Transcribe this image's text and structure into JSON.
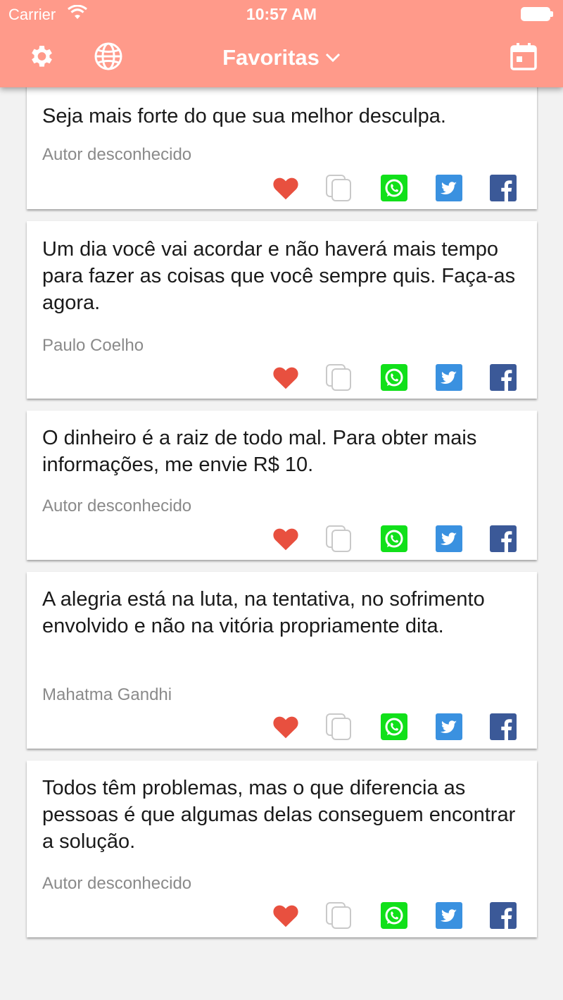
{
  "status": {
    "carrier": "Carrier",
    "time": "10:57 AM"
  },
  "nav": {
    "title": "Favoritas",
    "left_icons": [
      "gear-icon",
      "globe-icon"
    ],
    "right_icon": "calendar-icon",
    "color": "#ff9a8a"
  },
  "quotes": [
    {
      "text": "Seja mais forte do que sua melhor desculpa.",
      "author": "Autor desconhecido"
    },
    {
      "text": "Um dia você vai acordar e não haverá mais tempo para fazer as coisas que você sempre quis. Faça-as agora.",
      "author": "Paulo Coelho"
    },
    {
      "text": "O dinheiro é a raiz de todo mal. Para obter mais informações, me envie R$ 10.",
      "author": "Autor desconhecido"
    },
    {
      "text": "A alegria está na luta, na tentativa, no sofrimento envolvido e não na vitória propriamente dita.",
      "author": "Mahatma Gandhi"
    },
    {
      "text": "Todos têm problemas, mas o que diferencia as pessoas é que algumas delas conseguem encontrar a solução.",
      "author": "Autor desconhecido"
    }
  ],
  "action_icons": [
    "heart-icon",
    "copy-icon",
    "whatsapp-icon",
    "twitter-icon",
    "facebook-icon"
  ],
  "colors": {
    "heart": "#e8503f",
    "whatsapp": "#11e01a",
    "twitter": "#3a91e0",
    "facebook": "#3b5998"
  }
}
